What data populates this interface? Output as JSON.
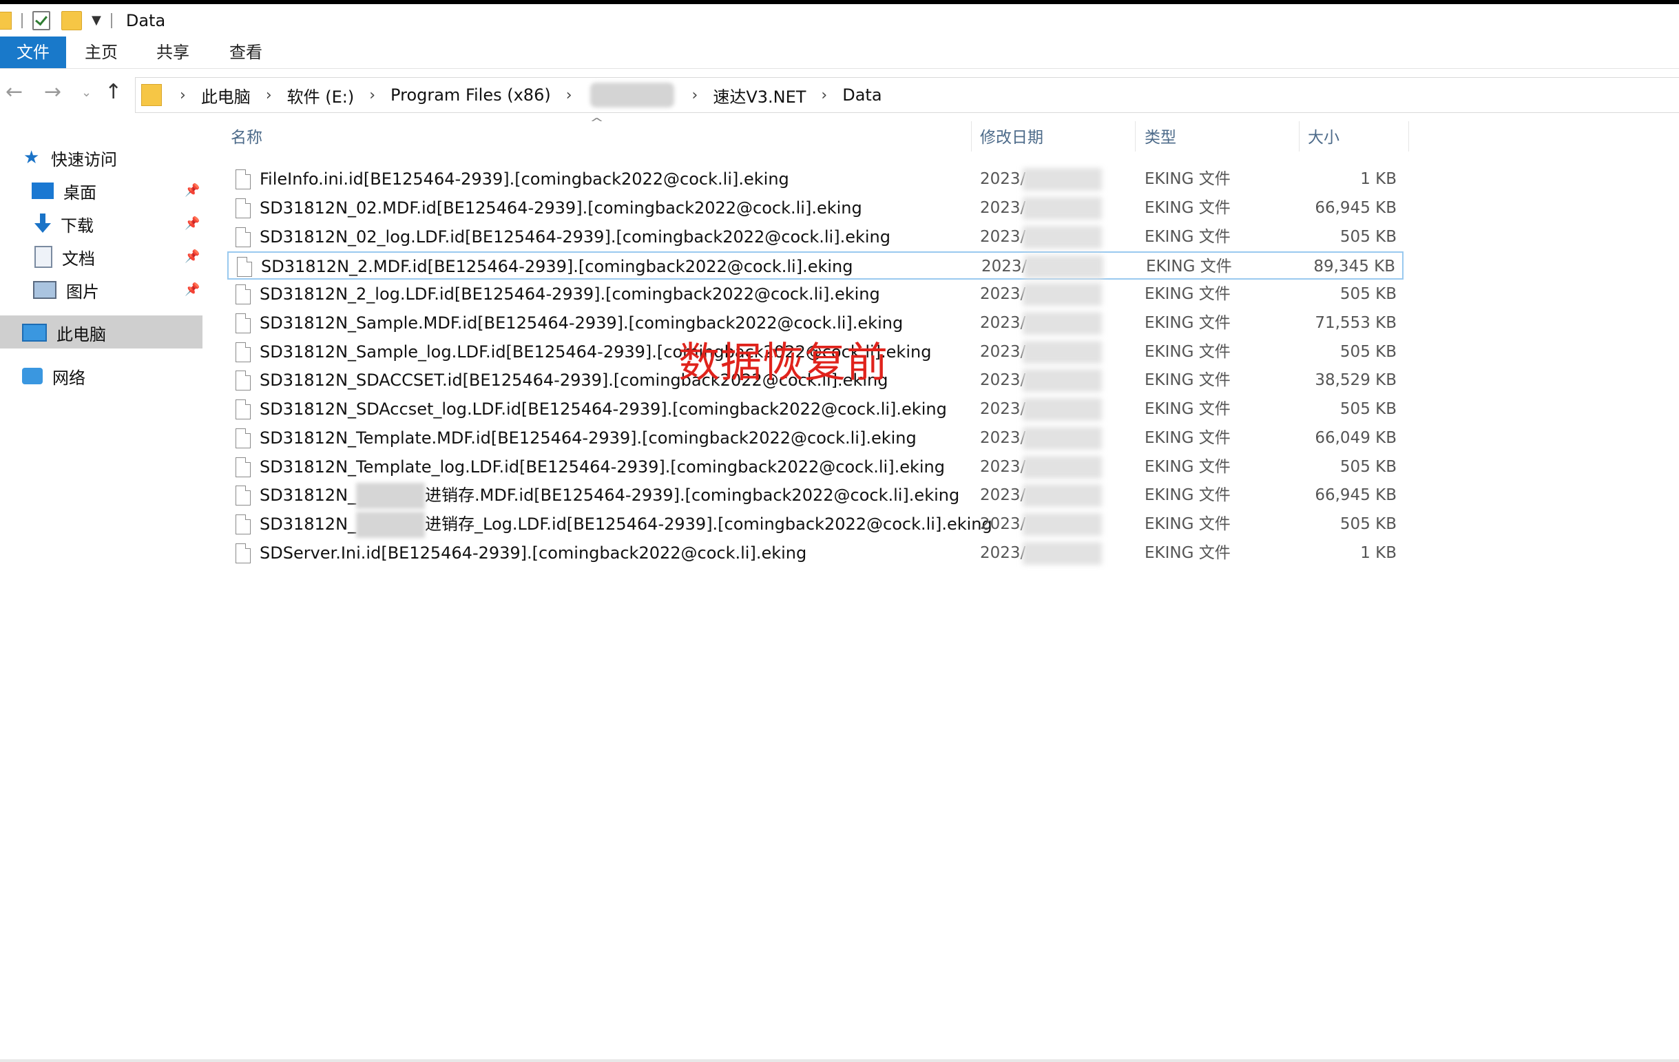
{
  "window": {
    "title": "Data"
  },
  "ribbon": {
    "tabs": [
      "文件",
      "主页",
      "共享",
      "查看"
    ]
  },
  "breadcrumb": [
    "此电脑",
    "软件 (E:)",
    "Program Files (x86)",
    "速达V3.NET",
    "Data"
  ],
  "sidebar": {
    "quick_access": "快速访问",
    "items": [
      "桌面",
      "下载",
      "文档",
      "图片"
    ],
    "this_pc": "此电脑",
    "network": "网络"
  },
  "columns": {
    "name": "名称",
    "date": "修改日期",
    "type": "类型",
    "size": "大小"
  },
  "files": [
    {
      "name": "FileInfo.ini.id[BE125464-2939].[comingback2022@cock.li].eking",
      "date": "2023/",
      "type": "EKING 文件",
      "size": "1 KB"
    },
    {
      "name": "SD31812N_02.MDF.id[BE125464-2939].[comingback2022@cock.li].eking",
      "date": "2023/",
      "type": "EKING 文件",
      "size": "66,945 KB"
    },
    {
      "name": "SD31812N_02_log.LDF.id[BE125464-2939].[comingback2022@cock.li].eking",
      "date": "2023/",
      "type": "EKING 文件",
      "size": "505 KB"
    },
    {
      "name": "SD31812N_2.MDF.id[BE125464-2939].[comingback2022@cock.li].eking",
      "date": "2023/",
      "type": "EKING 文件",
      "size": "89,345 KB"
    },
    {
      "name": "SD31812N_2_log.LDF.id[BE125464-2939].[comingback2022@cock.li].eking",
      "date": "2023/",
      "type": "EKING 文件",
      "size": "505 KB"
    },
    {
      "name": "SD31812N_Sample.MDF.id[BE125464-2939].[comingback2022@cock.li].eking",
      "date": "2023/",
      "type": "EKING 文件",
      "size": "71,553 KB"
    },
    {
      "name": "SD31812N_Sample_log.LDF.id[BE125464-2939].[comingback2022@cock.li].eking",
      "date": "2023/",
      "type": "EKING 文件",
      "size": "505 KB"
    },
    {
      "name": "SD31812N_SDACCSET.id[BE125464-2939].[comingback2022@cock.li].eking",
      "date": "2023/",
      "type": "EKING 文件",
      "size": "38,529 KB"
    },
    {
      "name": "SD31812N_SDAccset_log.LDF.id[BE125464-2939].[comingback2022@cock.li].eking",
      "date": "2023/",
      "type": "EKING 文件",
      "size": "505 KB"
    },
    {
      "name": "SD31812N_Template.MDF.id[BE125464-2939].[comingback2022@cock.li].eking",
      "date": "2023/",
      "type": "EKING 文件",
      "size": "66,049 KB"
    },
    {
      "name": "SD31812N_Template_log.LDF.id[BE125464-2939].[comingback2022@cock.li].eking",
      "date": "2023/",
      "type": "EKING 文件",
      "size": "505 KB"
    },
    {
      "name_prefix": "SD31812N_",
      "name": "进销存.MDF.id[BE125464-2939].[comingback2022@cock.li].eking",
      "date": "2023/",
      "type": "EKING 文件",
      "size": "66,945 KB"
    },
    {
      "name_prefix": "SD31812N_",
      "name": "进销存_Log.LDF.id[BE125464-2939].[comingback2022@cock.li].eking",
      "date": "2023/",
      "type": "EKING 文件",
      "size": "505 KB"
    },
    {
      "name": "SDServer.Ini.id[BE125464-2939].[comingback2022@cock.li].eking",
      "date": "2023/",
      "type": "EKING 文件",
      "size": "1 KB"
    }
  ],
  "overlay_text": "数据恢复前"
}
